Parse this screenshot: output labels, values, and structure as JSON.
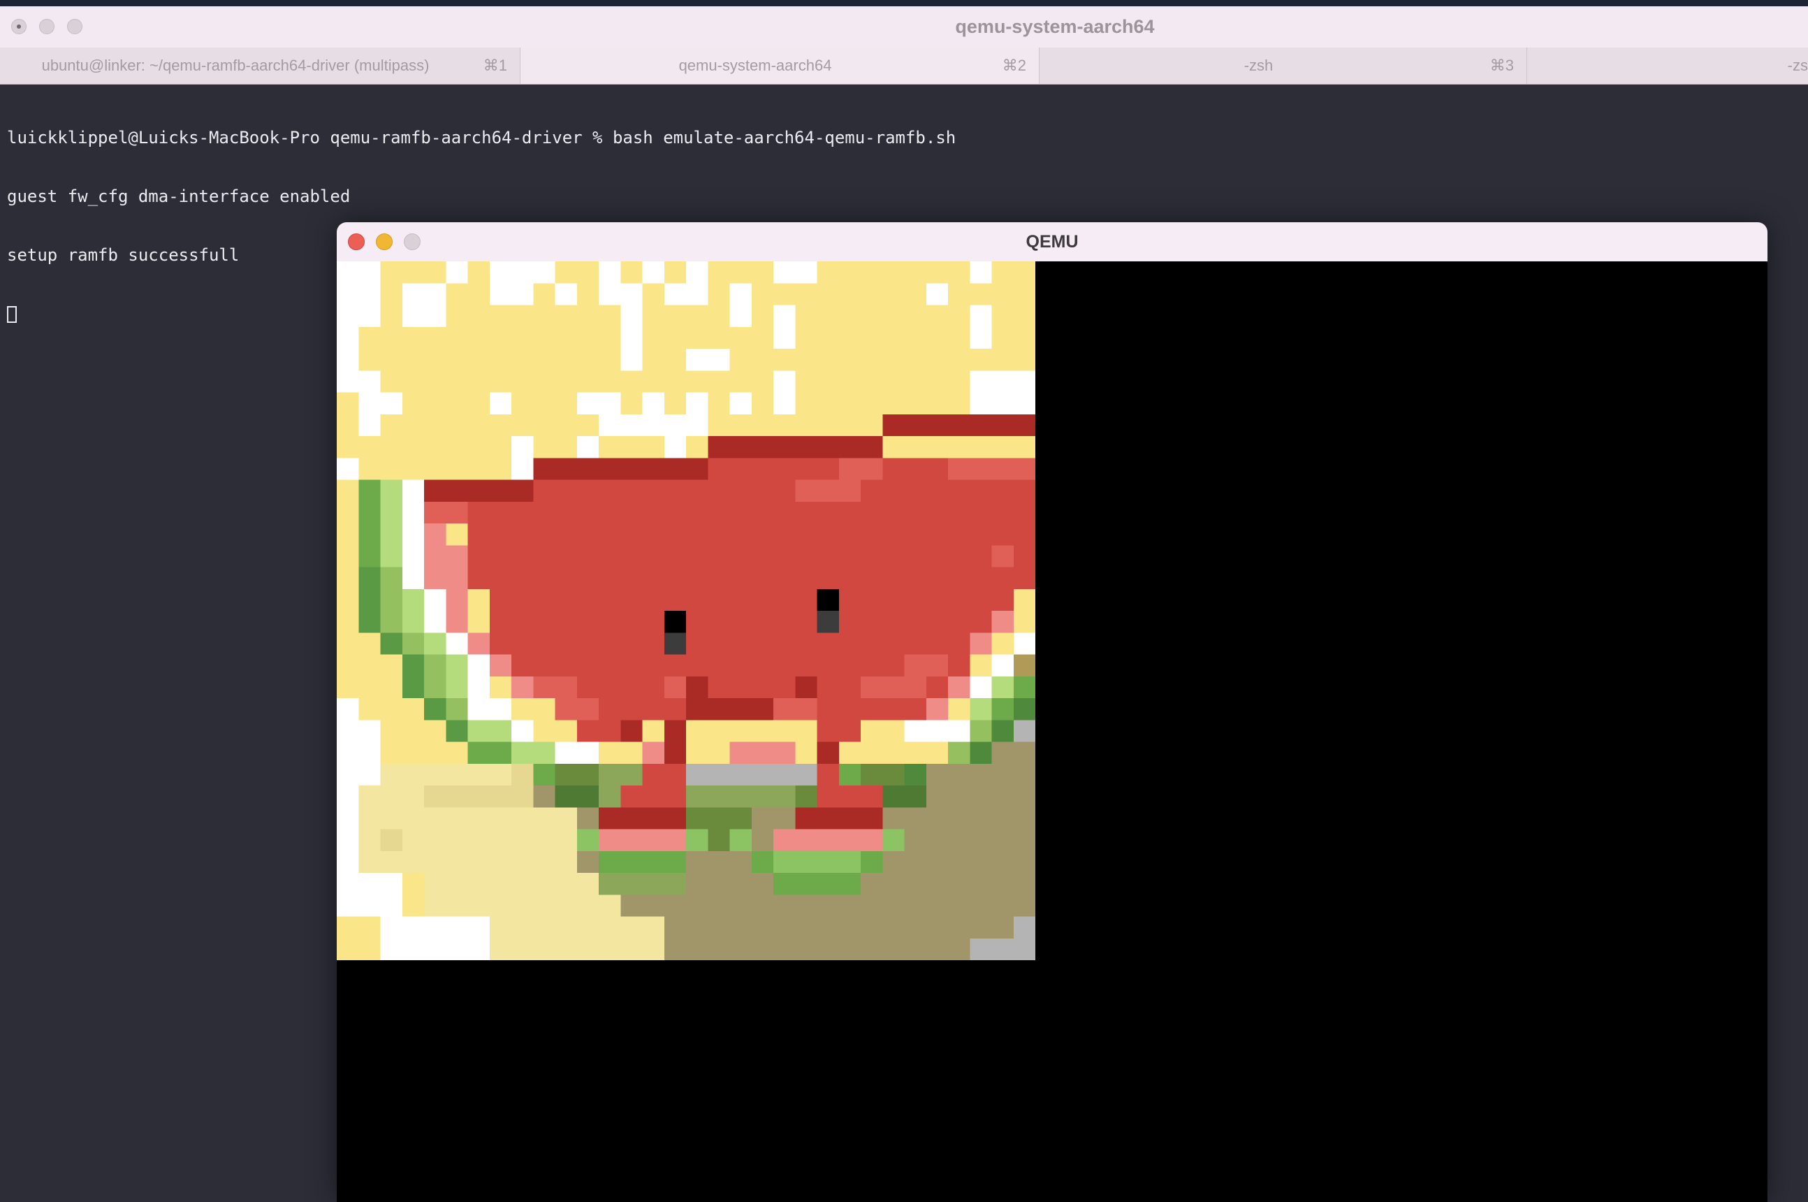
{
  "terminal": {
    "window_title": "qemu-system-aarch64",
    "tabs": [
      {
        "label": "ubuntu@linker: ~/qemu-ramfb-aarch64-driver (multipass)",
        "shortcut": "⌘1"
      },
      {
        "label": "qemu-system-aarch64",
        "shortcut": "⌘2"
      },
      {
        "label": "-zsh",
        "shortcut": "⌘3"
      },
      {
        "label": "-zs",
        "shortcut": ""
      }
    ],
    "lines": [
      "luickklippel@Luicks-MacBook-Pro qemu-ramfb-aarch64-driver % bash emulate-aarch64-qemu-ramfb.sh",
      "guest fw_cfg dma-interface enabled",
      "setup ramfb successfull"
    ]
  },
  "qemu": {
    "window_title": "QEMU",
    "framebuffer_image": "pixel-art-watermelon-slice-character"
  },
  "colors": {
    "yellow": "#fae688",
    "white": "#ffffff",
    "dark_red": "#aa2a25",
    "red": "#d04840",
    "light_red": "#e06058",
    "pink": "#f08c88",
    "green": "#8cc464",
    "dark_green": "#5a8a3c",
    "cream": "#f2e6a0",
    "olive": "#a0966a",
    "gray": "#b4b4b4"
  }
}
